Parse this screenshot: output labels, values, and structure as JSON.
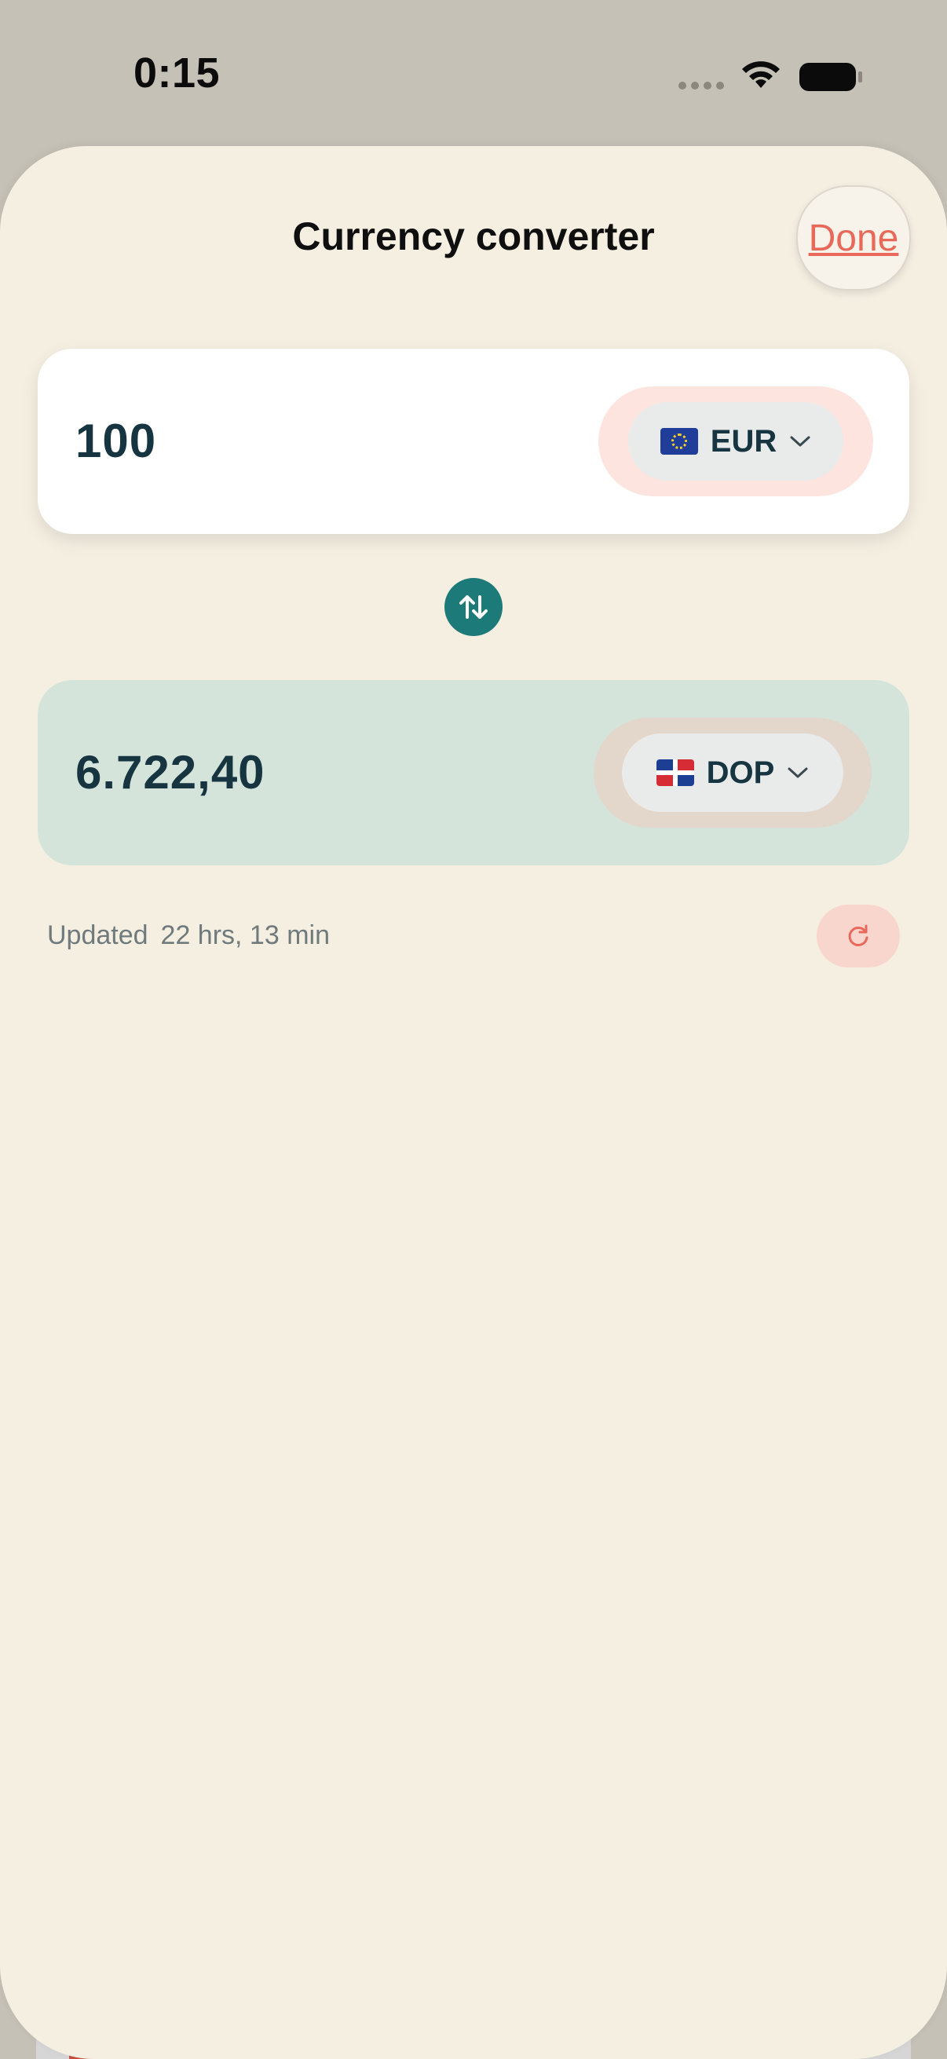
{
  "status_bar": {
    "time": "0:15"
  },
  "sheet": {
    "title": "Currency converter",
    "done_label": "Done"
  },
  "converter": {
    "from": {
      "amount": "100",
      "currency_code": "EUR",
      "flag": "eu-flag-icon"
    },
    "to": {
      "amount": "6.722,40",
      "currency_code": "DOP",
      "flag": "dominican-republic-flag-icon"
    },
    "updated_label": "Updated",
    "updated_ago": "22 hrs, 13 min"
  },
  "colors": {
    "sheet_background": "#f5efe2",
    "accent_red": "#e8695a",
    "swap_teal": "#1c7a78",
    "result_card": "#d5e4da",
    "amount_text": "#173540"
  },
  "icons": {
    "swap": "swap-vertical-icon",
    "refresh": "refresh-icon",
    "chevron": "chevron-down-icon"
  }
}
